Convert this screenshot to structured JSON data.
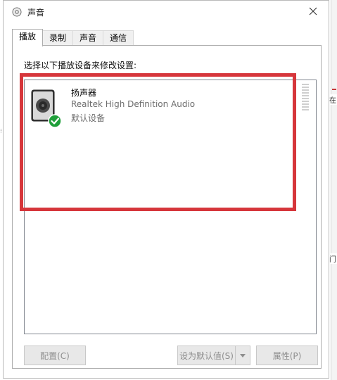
{
  "window": {
    "title": "声音",
    "icon": "speaker-icon"
  },
  "tabs": [
    {
      "label": "播放",
      "active": true
    },
    {
      "label": "录制",
      "active": false
    },
    {
      "label": "声音",
      "active": false
    },
    {
      "label": "通信",
      "active": false
    }
  ],
  "panel": {
    "instruction": "选择以下播放设备来修改设置:",
    "devices": [
      {
        "name": "扬声器",
        "driver": "Realtek High Definition Audio",
        "status": "默认设备",
        "icon": "speaker-device-icon",
        "badge": "green-check-icon"
      }
    ]
  },
  "buttons": {
    "configure": "配置(C)",
    "set_default": "设为默认值(S)",
    "properties": "属性(P)"
  },
  "background": {
    "edge_top": "在",
    "edge_mid": "门"
  },
  "colors": {
    "highlight": "#d6363b",
    "check": "#1f9f3a"
  }
}
